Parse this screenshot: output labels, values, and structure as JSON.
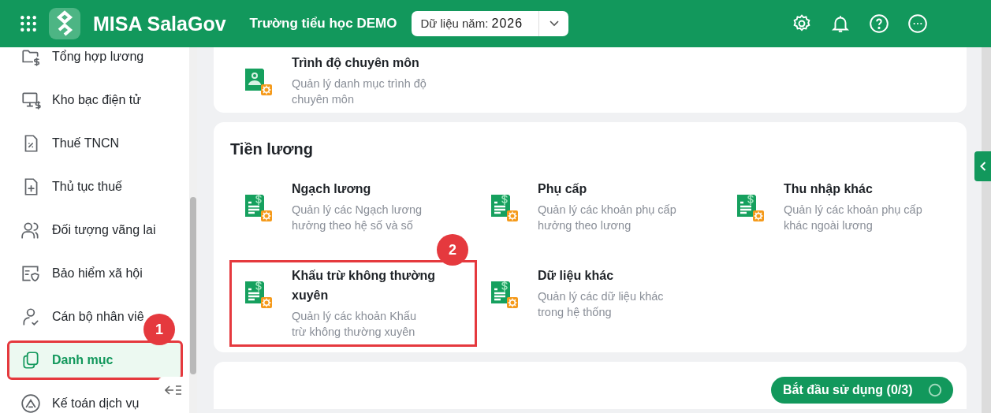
{
  "header": {
    "app_name": "MISA SalaGov",
    "school": "Trường tiểu học DEMO",
    "year_label": "Dữ liệu năm:",
    "year": "2026"
  },
  "sidebar": {
    "items": [
      {
        "label": "Tổng hợp lương",
        "selected": false,
        "highlighted": false
      },
      {
        "label": "Kho bạc điện tử",
        "selected": false,
        "highlighted": false
      },
      {
        "label": "Thuế TNCN",
        "selected": false,
        "highlighted": false
      },
      {
        "label": "Thủ tục thuế",
        "selected": false,
        "highlighted": false
      },
      {
        "label": "Đối tượng vãng lai",
        "selected": false,
        "highlighted": false
      },
      {
        "label": "Bảo hiểm xã hội",
        "selected": false,
        "highlighted": false
      },
      {
        "label": "Cán bộ nhân viê",
        "selected": false,
        "highlighted": false
      },
      {
        "label": "Danh mục",
        "selected": true,
        "highlighted": true,
        "step": "1"
      },
      {
        "label": "Kế toán dịch vụ",
        "selected": false,
        "highlighted": false
      }
    ]
  },
  "sections": [
    {
      "tiles": [
        {
          "kind": "person",
          "title": "Trình độ chuyên môn",
          "description": "Quản lý danh mục trình độ chuyên môn",
          "highlighted": false
        }
      ]
    },
    {
      "title": "Tiền lương",
      "tiles": [
        {
          "kind": "money",
          "title": "Ngạch lương",
          "description": "Quản lý các Ngạch lương hưởng theo hệ số và số",
          "highlighted": false
        },
        {
          "kind": "money",
          "title": "Phụ cấp",
          "description": "Quản lý các khoản phụ cấp hưởng theo lương",
          "highlighted": false
        },
        {
          "kind": "money",
          "title": "Thu nhập khác",
          "description": "Quản lý các khoản phụ cấp khác ngoài lương",
          "highlighted": false
        },
        {
          "kind": "money",
          "title": "Khấu trừ không thường xuyên",
          "description": "Quản lý các khoản Khấu trừ không thường xuyên",
          "highlighted": true,
          "step": "2"
        },
        {
          "kind": "money",
          "title": "Dữ liệu khác",
          "description": "Quản lý các dữ liệu khác trong hệ thống",
          "highlighted": false
        }
      ]
    }
  ],
  "onboarding": {
    "label": "Bắt đầu sử dụng (0/3)"
  }
}
